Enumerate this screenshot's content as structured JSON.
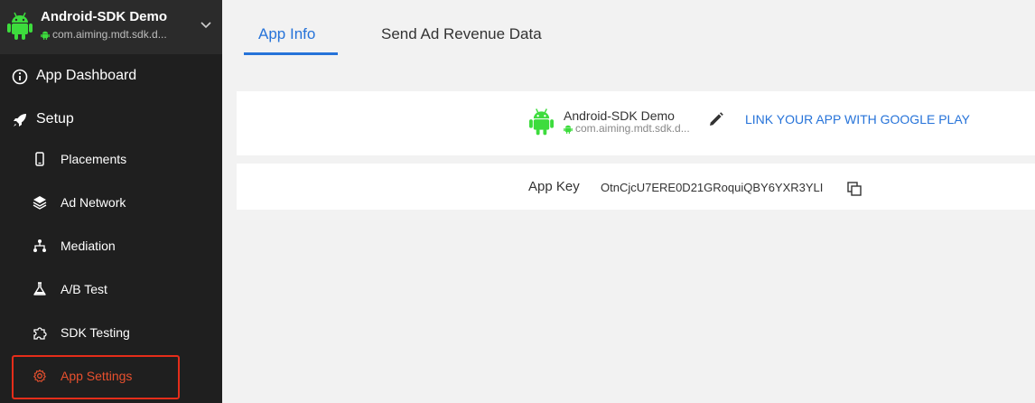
{
  "app": {
    "name": "Android-SDK Demo",
    "package": "com.aiming.mdt.sdk.d..."
  },
  "sidebar": {
    "top_items": [
      {
        "label": "App Dashboard",
        "icon": "info-circle-icon"
      },
      {
        "label": "Setup",
        "icon": "rocket-icon"
      }
    ],
    "sub_items": [
      {
        "label": "Placements",
        "icon": "phone-icon"
      },
      {
        "label": "Ad Network",
        "icon": "layers-icon"
      },
      {
        "label": "Mediation",
        "icon": "hierarchy-icon"
      },
      {
        "label": "A/B Test",
        "icon": "flask-icon"
      },
      {
        "label": "SDK Testing",
        "icon": "puzzle-icon"
      },
      {
        "label": "App Settings",
        "icon": "gear-icon",
        "active": true
      }
    ]
  },
  "tabs": [
    {
      "label": "App Info",
      "active": true
    },
    {
      "label": "Send Ad Revenue Data",
      "active": false
    }
  ],
  "app_card": {
    "name": "Android-SDK Demo",
    "package": "com.aiming.mdt.sdk.d...",
    "link_label": "LINK YOUR APP WITH GOOGLE PLAY"
  },
  "key_card": {
    "label": "App Key",
    "value": "OtnCjcU7ERE0D21GRoquiQBY6YXR3YLI"
  },
  "colors": {
    "sidebar_bg": "#1f1f1f",
    "accent": "#2673d9",
    "active_nav": "#e8502e",
    "android_green": "#3ddc3d",
    "highlight_border": "#e52d1a"
  }
}
